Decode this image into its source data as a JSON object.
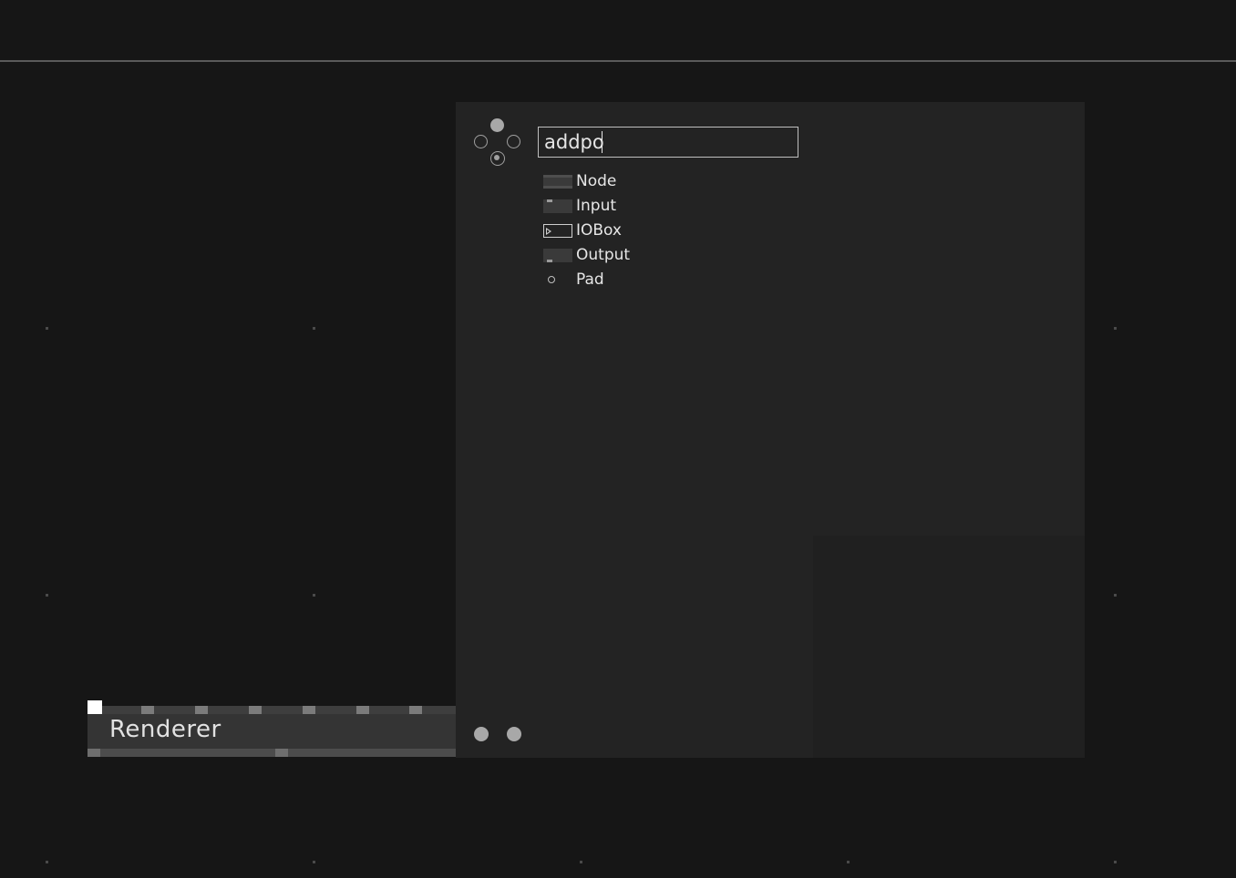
{
  "canvas": {
    "background": "#161616",
    "renderer_node": {
      "label": "Renderer"
    }
  },
  "node_browser": {
    "search": {
      "value": "addpo",
      "placeholder": ""
    },
    "items": [
      {
        "label": "Node",
        "icon": "node-icon"
      },
      {
        "label": "Input",
        "icon": "input-icon"
      },
      {
        "label": "IOBox",
        "icon": "iobox-icon"
      },
      {
        "label": "Output",
        "icon": "output-icon"
      },
      {
        "label": "Pad",
        "icon": "pad-icon"
      }
    ]
  }
}
